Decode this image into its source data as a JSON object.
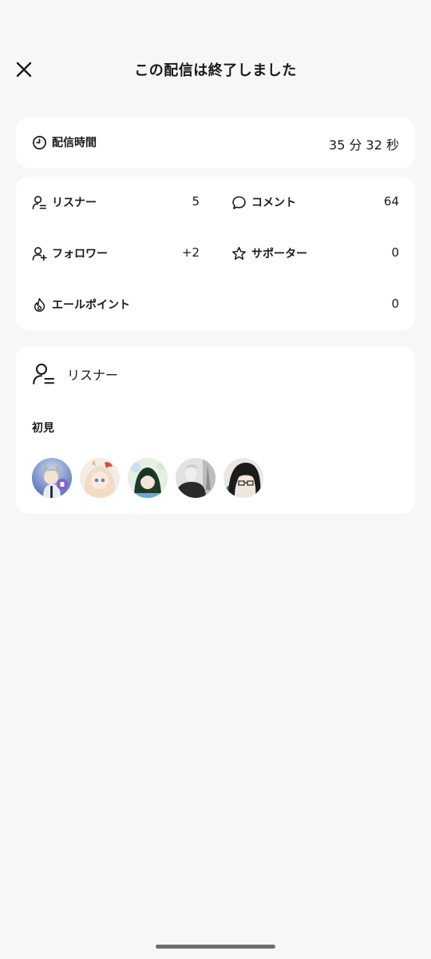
{
  "header": {
    "title": "この配信は終了しました",
    "close_icon": "close-icon"
  },
  "duration": {
    "label": "配信時間",
    "value": "35 分 32 秒",
    "icon": "clock-icon"
  },
  "stats": {
    "listeners": {
      "label": "リスナー",
      "value": "5",
      "icon": "listener-icon"
    },
    "comments": {
      "label": "コメント",
      "value": "64",
      "icon": "comment-icon"
    },
    "followers": {
      "label": "フォロワー",
      "value": "+2",
      "icon": "follower-add-icon"
    },
    "supporters": {
      "label": "サポーター",
      "value": "0",
      "icon": "star-icon"
    },
    "cheer_points": {
      "label": "エールポイント",
      "value": "0",
      "icon": "flame-icon"
    }
  },
  "listeners_section": {
    "title": "リスナー",
    "icon": "listener-icon",
    "first_time_label": "初見",
    "avatar_count": 5
  }
}
